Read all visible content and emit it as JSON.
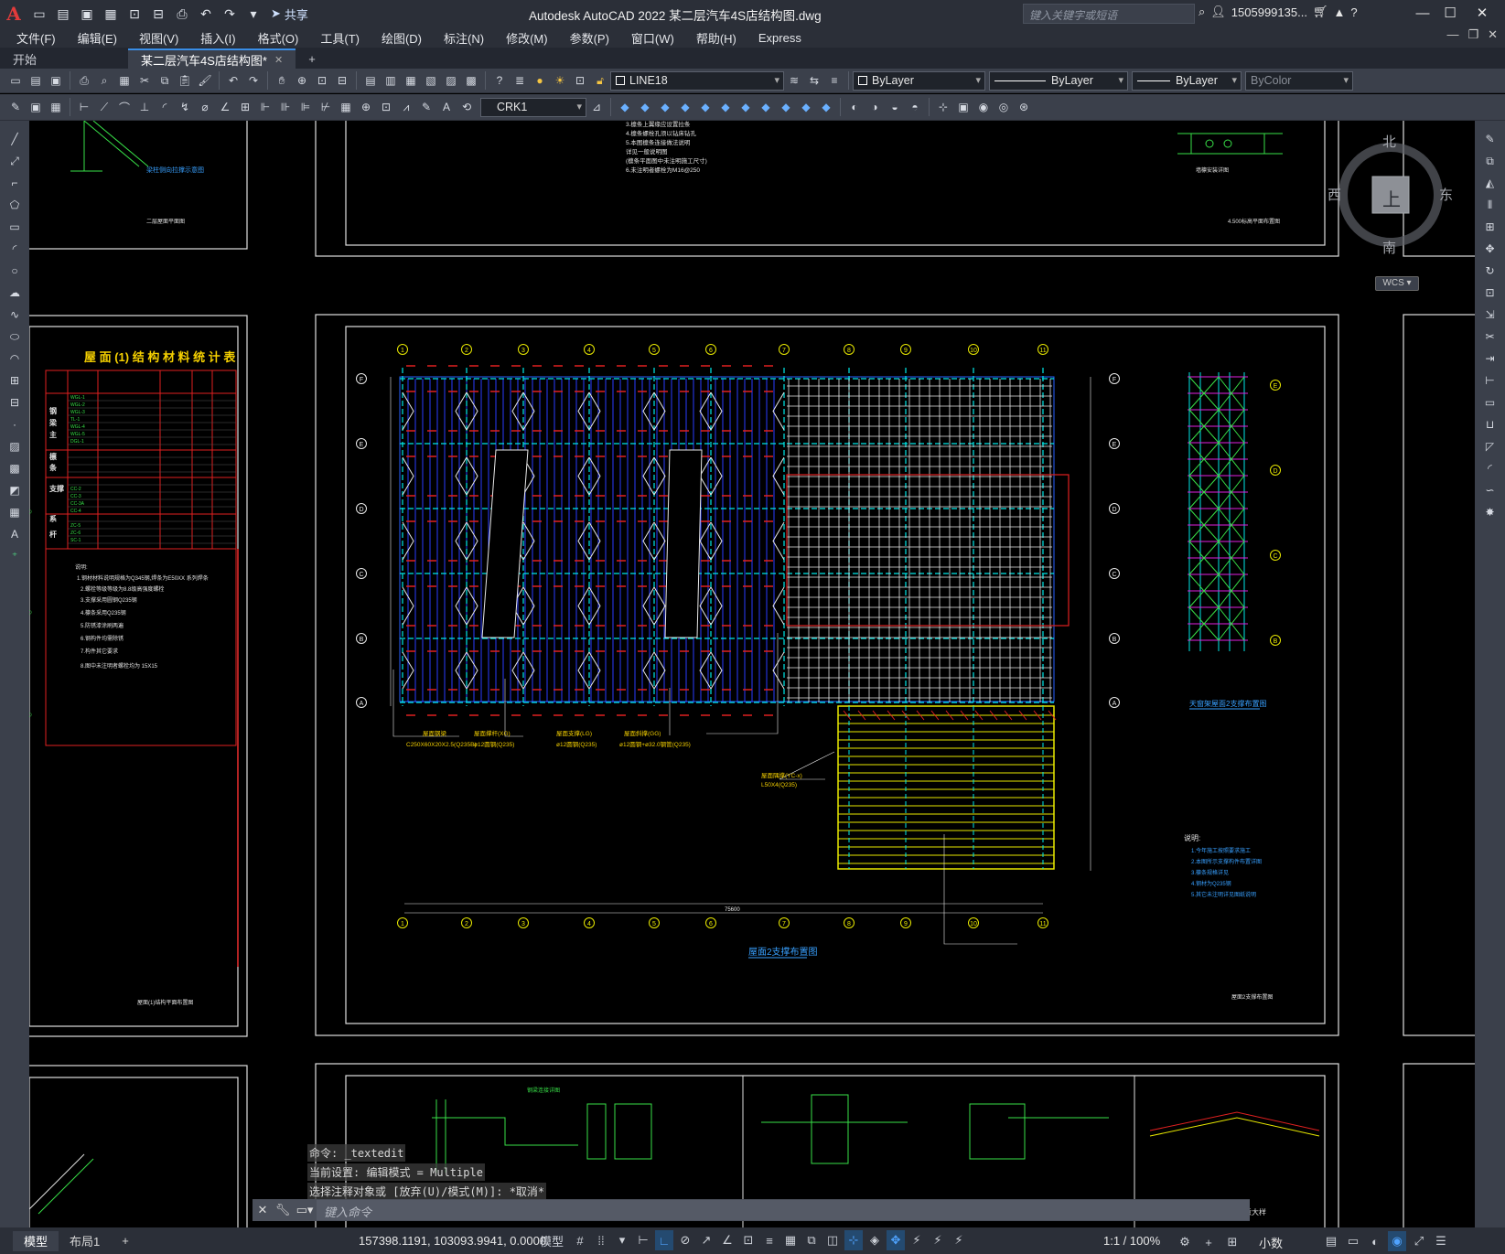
{
  "app": {
    "title": "Autodesk AutoCAD 2022    某二层汽车4S店结构图.dwg",
    "share_label": "共享",
    "search_placeholder": "键入关键字或短语",
    "user": "1505999135...",
    "logo_letter": "A"
  },
  "menu": [
    "文件(F)",
    "编辑(E)",
    "视图(V)",
    "插入(I)",
    "格式(O)",
    "工具(T)",
    "绘图(D)",
    "标注(N)",
    "修改(M)",
    "参数(P)",
    "窗口(W)",
    "帮助(H)",
    "Express"
  ],
  "tabs": {
    "start": "开始",
    "active": "某二层汽车4S店结构图*"
  },
  "toolbar": {
    "layer": "LINE18",
    "color": "ByLayer",
    "linetype": "ByLayer",
    "lineweight": "ByLayer",
    "plotstyle": "ByColor",
    "dimstyle": "CRK1"
  },
  "viewcube": {
    "north": "北",
    "south": "南",
    "east": "东",
    "west": "西",
    "top": "上",
    "wcs": "WCS"
  },
  "drawing": {
    "material_table_title": "屋 面 (1) 结 构 材 料 统 计 表",
    "main_plan_title": "屋面2支撑布置图",
    "side_plan_title": "天窗架屋面2支撑布置图",
    "notes_heading": "说明:",
    "lower_detail_caption": "屋面檩条安装示意大样",
    "axis_top": [
      "1",
      "2",
      "3",
      "4",
      "5",
      "6",
      "7",
      "8",
      "9",
      "10",
      "11"
    ],
    "axis_rows": [
      "F",
      "E",
      "D",
      "C",
      "B",
      "A"
    ],
    "side_rows": [
      "E",
      "D",
      "C",
      "B"
    ],
    "notes_left": [
      "1.钢材材料说明规格为Q345钢,焊条为E50XX 系列焊条",
      "2.螺栓等级等级为8.8级高强度螺栓",
      "3.支撑采用圆钢Q235钢",
      "4.檩条采用Q235钢",
      "5.防锈漆涂刷两遍",
      "6.钢构件均需除锈",
      "7.构件其它要求",
      "8.图中未注明者螺栓均为 15X15"
    ],
    "notes_right": [
      "1.今年施工按照要求施工",
      "2.本图所示支撑构件布置详图",
      "3.檩条规格详见",
      "4.钢材为Q235钢",
      "5.其它未注明详见图纸说明"
    ],
    "labels_bottom": [
      "屋面钢梁",
      "屋面撑杆(XG)",
      "屋面支撑(LG)",
      "屋面斜撑(GG)",
      "屋面隅撑(YC-x)"
    ],
    "label_specs": [
      "C250X60X20X2.5(Q235B)",
      "ø12圆钢(Q235)",
      "ø12圆钢(Q235)",
      "ø12圆钢+ø32.0钢管(Q235)",
      "L50X4(Q235)"
    ],
    "dim_total": "75600"
  },
  "command": {
    "history": [
      "命令: _textedit",
      "当前设置: 编辑模式 = Multiple",
      "选择注释对象或 [放弃(U)/模式(M)]: *取消*"
    ],
    "placeholder": "键入命令"
  },
  "status": {
    "layout_model": "模型",
    "layout1": "布局1",
    "coords": "157398.1191, 103093.9941, 0.0000",
    "space": "模型",
    "scale": "1:1 / 100%",
    "units": "小数"
  }
}
